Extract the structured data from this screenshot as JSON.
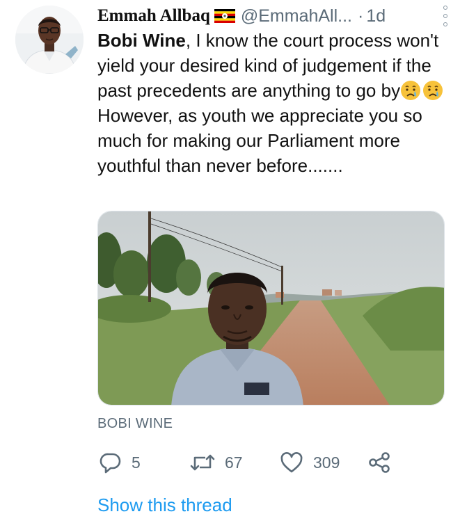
{
  "tweet": {
    "author": {
      "display_name": "Emmah Allbaq",
      "flag_icon": "uganda-flag-icon",
      "handle": "@EmmahAll...",
      "separator": "·",
      "timestamp": "1d"
    },
    "more_icon": "vertical-dots-icon",
    "text": {
      "mention": "Bobi Wine",
      "part1": ", I know the court process won't yield your desired kind of judgement if the past precedents are anything to go by",
      "emojis": [
        "crying-face-icon",
        "crying-face-icon"
      ],
      "part2": " However, as youth we appreciate you so much for making our Parliament more youthful than never before......."
    },
    "media": {
      "caption": "BOBI WINE"
    },
    "actions": {
      "reply": {
        "icon": "reply-icon",
        "count": "5"
      },
      "retweet": {
        "icon": "retweet-icon",
        "count": "67"
      },
      "like": {
        "icon": "heart-icon",
        "count": "309"
      },
      "share": {
        "icon": "share-icon"
      }
    },
    "show_thread_label": "Show this thread",
    "colors": {
      "link": "#1d9bf0",
      "muted": "#5b6b78",
      "text": "#111111"
    }
  }
}
